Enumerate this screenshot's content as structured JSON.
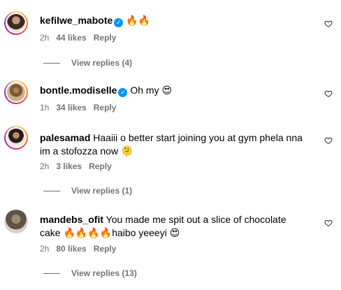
{
  "comments": [
    {
      "username": "kefilwe_mabote",
      "verified": true,
      "text": "",
      "emoji": "🔥🔥",
      "time": "2h",
      "likes": "44 likes",
      "reply": "Reply",
      "view_replies": "View replies (4)"
    },
    {
      "username": "bontle.modiselle",
      "verified": true,
      "text": "Oh my",
      "emoji": "😍",
      "time": "1h",
      "likes": "34 likes",
      "reply": "Reply",
      "view_replies": ""
    },
    {
      "username": "palesamad",
      "verified": false,
      "text": "Haaiii o better start joining you at gym phela nna im a stofozza now 🫠",
      "time": "2h",
      "likes": "3 likes",
      "reply": "Reply",
      "view_replies": "View replies (1)"
    },
    {
      "username": "mandebs_ofit",
      "verified": false,
      "text": "You made me spit out a slice of chocolate cake",
      "emoji_start": "🔥🔥🔥🔥",
      "text2": "haibo yeeeyi",
      "emoji_end": "😍",
      "time": "2h",
      "likes": "80 likes",
      "reply": "Reply",
      "view_replies": "View replies (13)"
    }
  ],
  "icons": {
    "verified": "verified-badge-icon",
    "like": "heart-outline-icon"
  },
  "colors": {
    "secondary_text": "#737373",
    "verified_blue": "#0095f6"
  }
}
